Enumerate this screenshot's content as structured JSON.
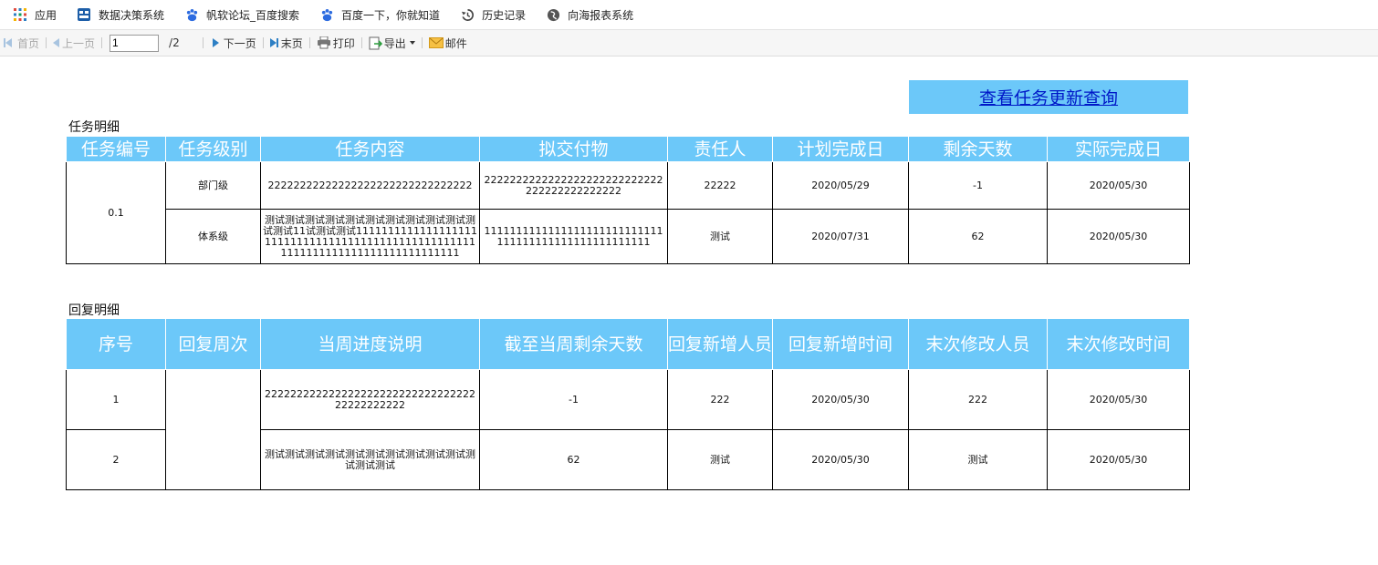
{
  "bookmarks": [
    {
      "label": "应用",
      "icon": "apps-grid-icon"
    },
    {
      "label": "数据决策系统",
      "icon": "finereport-logo-icon"
    },
    {
      "label": "帆软论坛_百度搜索",
      "icon": "baidu-paw-icon"
    },
    {
      "label": "百度一下，你就知道",
      "icon": "baidu-paw-icon"
    },
    {
      "label": "历史记录",
      "icon": "history-icon"
    },
    {
      "label": "向海报表系统",
      "icon": "globe-icon"
    }
  ],
  "toolbar": {
    "first": "首页",
    "prev": "上一页",
    "page_value": "1",
    "page_total": "/2",
    "next": "下一页",
    "last": "末页",
    "print": "打印",
    "export": "导出",
    "mail": "邮件"
  },
  "query_button": "查看任务更新查询",
  "task_section": {
    "title": "任务明细",
    "headers": [
      "任务编号",
      "任务级别",
      "任务内容",
      "拟交付物",
      "责任人",
      "计划完成日",
      "剩余天数",
      "实际完成日"
    ],
    "task_no": "0.1",
    "rows": [
      {
        "level": "部门级",
        "content": "22222222222222222222222222222222",
        "deliverable": "2222222222222222222222222222222222222222222",
        "owner": "22222",
        "plan_date": "2020/05/29",
        "remaining": "-1",
        "actual_date": "2020/05/30"
      },
      {
        "level": "体系级",
        "content": "测试测试测试测试测试测试测试测试测试测试测试测试11试测试测试11111111111111111111111111111111111111111111111111111111111111111111111111111111",
        "deliverable": "1111111111111111111111111111111111111111111111111111",
        "owner": "测试",
        "plan_date": "2020/07/31",
        "remaining": "62",
        "actual_date": "2020/05/30"
      }
    ]
  },
  "reply_section": {
    "title": "回复明细",
    "headers": [
      "序号",
      "回复周次",
      "当周进度说明",
      "截至当周剩余天数",
      "回复新增人员",
      "回复新增时间",
      "末次修改人员",
      "末次修改时间"
    ],
    "week": "",
    "rows": [
      {
        "no": "1",
        "progress": "22222222222222222222222222222222222222222222",
        "remaining": "-1",
        "added_by": "222",
        "added_time": "2020/05/30",
        "modified_by": "222",
        "modified_time": "2020/05/30"
      },
      {
        "no": "2",
        "progress": "测试测试测试测试测试测试测试测试测试测试测试测试测试",
        "remaining": "62",
        "added_by": "测试",
        "added_time": "2020/05/30",
        "modified_by": "测试",
        "modified_time": "2020/05/30"
      }
    ]
  },
  "colors": {
    "header_bg": "#6cc8f9",
    "link": "#0018c8",
    "arrow_blue": "#2d7fc4"
  }
}
